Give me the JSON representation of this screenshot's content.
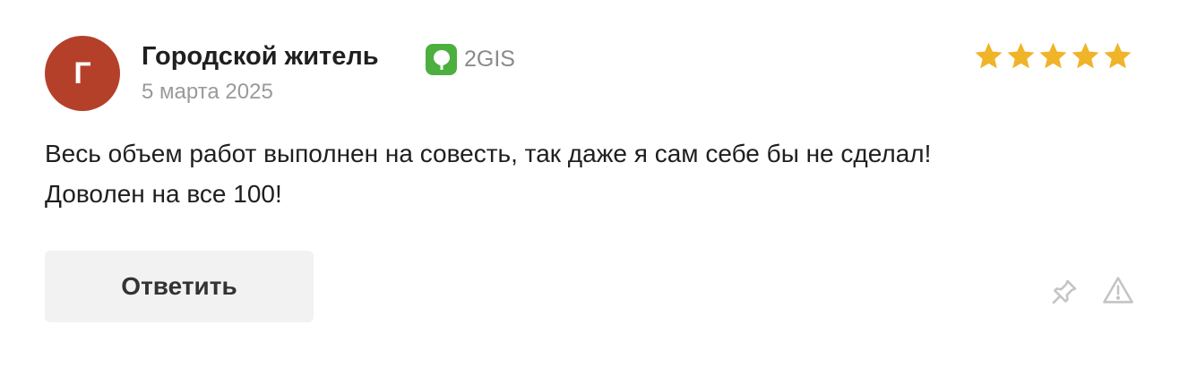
{
  "review": {
    "avatar_letter": "Г",
    "avatar_color": "#b5402a",
    "author": "Городской житель",
    "source": {
      "label": "2GIS",
      "icon": "2gis-logo-icon",
      "color": "#4caf3f"
    },
    "date": "5 марта 2025",
    "rating": 5,
    "rating_max": 5,
    "star_color": "#f0b429",
    "text_line1": "Весь объем работ выполнен на совесть, так даже я сам себе бы не сделал!",
    "text_line2": "Доволен на все 100!"
  },
  "actions": {
    "reply_label": "Ответить",
    "pin_icon": "pin-icon",
    "report_icon": "warning-icon"
  }
}
